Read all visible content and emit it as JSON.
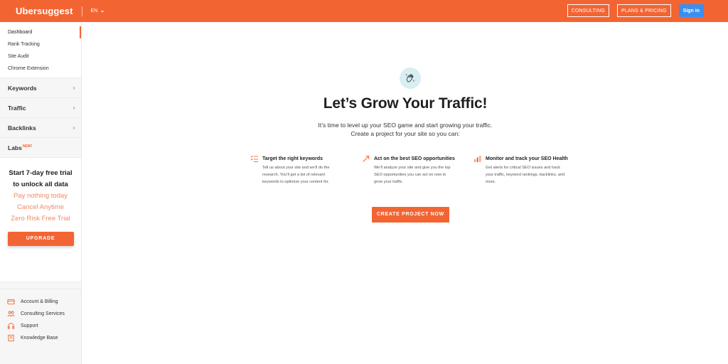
{
  "header": {
    "brand": "Ubersuggest",
    "language": "EN",
    "consulting_label": "CONSULTING",
    "pricing_label": "PLANS & PRICING",
    "signin_label": "Sign in"
  },
  "sidebar": {
    "top_links": [
      {
        "label": "Dashboard"
      },
      {
        "label": "Rank Tracking"
      },
      {
        "label": "Site Audit"
      },
      {
        "label": "Chrome Extension"
      }
    ],
    "sections": [
      {
        "label": "Keywords"
      },
      {
        "label": "Traffic"
      },
      {
        "label": "Backlinks"
      }
    ],
    "labs_label": "Labs",
    "labs_badge": "NEW!",
    "trial": {
      "title_line1": "Start 7-day free trial",
      "title_line2": "to unlock all data",
      "benefits": [
        "Pay nothing today",
        "Cancel Anytime",
        "Zero Risk Free Trial"
      ],
      "upgrade_label": "UPGRADE"
    },
    "footer": [
      {
        "label": "Account & Billing",
        "icon": "credit-card-icon"
      },
      {
        "label": "Consulting Services",
        "icon": "people-icon"
      },
      {
        "label": "Support",
        "icon": "headset-icon"
      },
      {
        "label": "Knowledge Base",
        "icon": "book-icon"
      }
    ]
  },
  "main": {
    "hero_icon": "waving-hand-icon",
    "title": "Let’s Grow Your Traffic!",
    "subtitle_line1": "It’s time to level up your SEO game and start growing your traffic.",
    "subtitle_line2": "Create a project for your site so you can:",
    "features": [
      {
        "title": "Target the right keywords",
        "text": "Tell us about your site and we’ll do the research. You’ll get a list of relevant keywords to optimize your content for.",
        "icon": "list-icon"
      },
      {
        "title": "Act on the best SEO opportunities",
        "text": "We’ll analyze your site and give you the top SEO opportunities you can act on now to grow your traffic.",
        "icon": "trend-arrow-icon"
      },
      {
        "title": "Monitor and track your SEO Health",
        "text": "Get alerts for critical SEO issues and track your traffic, keyword rankings, backlinks, and more.",
        "icon": "health-chart-icon"
      }
    ],
    "cta_label": "CREATE PROJECT NOW"
  },
  "colors": {
    "accent": "#f26533",
    "signin": "#3b8ef0",
    "hero_icon_bg": "#d8eef0"
  }
}
